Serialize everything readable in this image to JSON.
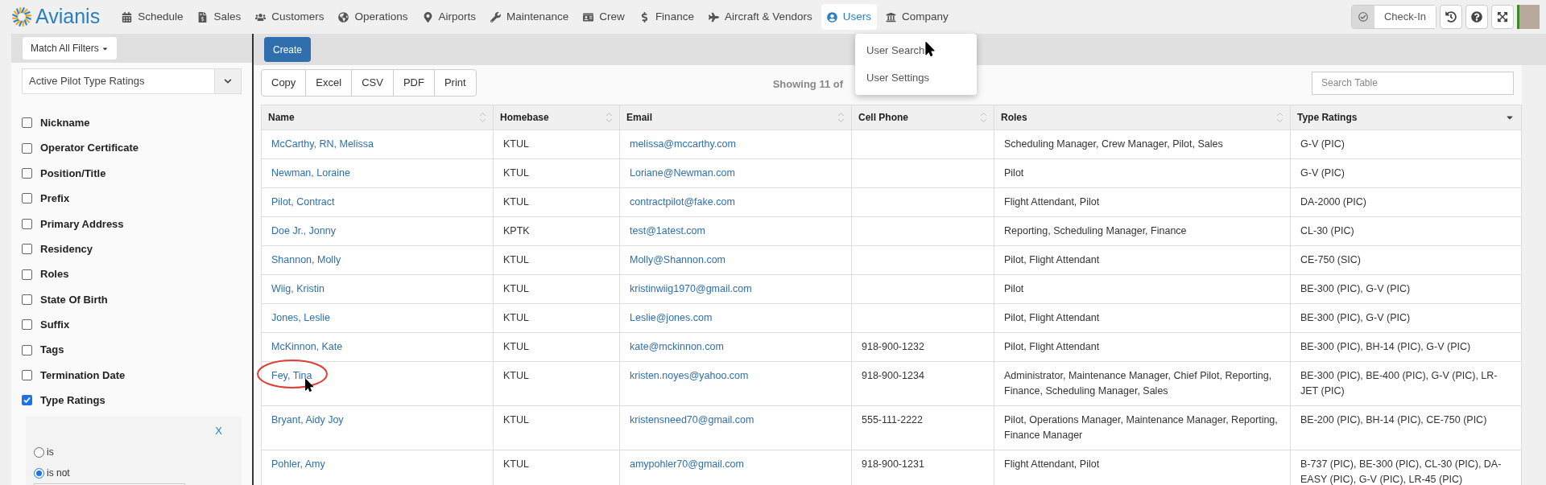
{
  "brand": "Avianis",
  "nav": [
    {
      "label": "Schedule",
      "selected": false
    },
    {
      "label": "Sales",
      "selected": false
    },
    {
      "label": "Customers",
      "selected": false
    },
    {
      "label": "Operations",
      "selected": false
    },
    {
      "label": "Airports",
      "selected": false
    },
    {
      "label": "Maintenance",
      "selected": false
    },
    {
      "label": "Crew",
      "selected": false
    },
    {
      "label": "Finance",
      "selected": false
    },
    {
      "label": "Aircraft & Vendors",
      "selected": false
    },
    {
      "label": "Users",
      "selected": true
    },
    {
      "label": "Company",
      "selected": false
    }
  ],
  "checkin": "Check-In",
  "user_menu": [
    "User Search",
    "User Settings"
  ],
  "sidebar": {
    "match_button": "Match All Filters",
    "select_value": "Active Pilot Type Ratings",
    "filters": [
      {
        "label": "Nickname",
        "checked": false
      },
      {
        "label": "Operator Certificate",
        "checked": false
      },
      {
        "label": "Position/Title",
        "checked": false
      },
      {
        "label": "Prefix",
        "checked": false
      },
      {
        "label": "Primary Address",
        "checked": false
      },
      {
        "label": "Residency",
        "checked": false
      },
      {
        "label": "Roles",
        "checked": false
      },
      {
        "label": "State Of Birth",
        "checked": false
      },
      {
        "label": "Suffix",
        "checked": false
      },
      {
        "label": "Tags",
        "checked": false
      },
      {
        "label": "Termination Date",
        "checked": false
      },
      {
        "label": "Type Ratings",
        "checked": true
      }
    ],
    "panel": {
      "close": "X",
      "options": [
        {
          "label": "is",
          "selected": false
        },
        {
          "label": "is not",
          "selected": true
        }
      ]
    }
  },
  "create_button": "Create",
  "export_buttons": [
    "Copy",
    "Excel",
    "CSV",
    "PDF",
    "Print"
  ],
  "showing": "Showing 11 of",
  "search": {
    "placeholder": "Search Table"
  },
  "table": {
    "columns": [
      {
        "label": "Name",
        "sorted": false
      },
      {
        "label": "Homebase",
        "sorted": false
      },
      {
        "label": "Email",
        "sorted": false
      },
      {
        "label": "Cell Phone",
        "sorted": false
      },
      {
        "label": "Roles",
        "sorted": false
      },
      {
        "label": "Type Ratings",
        "sorted": true
      }
    ],
    "rows": [
      [
        "McCarthy, RN, Melissa",
        "KTUL",
        "melissa@mccarthy.com",
        "",
        "Scheduling Manager, Crew Manager, Pilot, Sales",
        "G-V (PIC)"
      ],
      [
        "Newman, Loraine",
        "KTUL",
        "Loriane@Newman.com",
        "",
        "Pilot",
        "G-V (PIC)"
      ],
      [
        "Pilot, Contract",
        "KTUL",
        "contractpilot@fake.com",
        "",
        "Flight Attendant, Pilot",
        "DA-2000 (PIC)"
      ],
      [
        "Doe Jr., Jonny",
        "KPTK",
        "test@1atest.com",
        "",
        "Reporting, Scheduling Manager, Finance",
        "CL-30 (PIC)"
      ],
      [
        "Shannon, Molly",
        "KTUL",
        "Molly@Shannon.com",
        "",
        "Pilot, Flight Attendant",
        "CE-750 (SIC)"
      ],
      [
        "Wiig, Kristin",
        "KTUL",
        "kristinwiig1970@gmail.com",
        "",
        "Pilot",
        "BE-300 (PIC), G-V (PIC)"
      ],
      [
        "Jones, Leslie",
        "KTUL",
        "Leslie@jones.com",
        "",
        "Pilot, Flight Attendant",
        "BE-300 (PIC), G-V (PIC)"
      ],
      [
        "McKinnon, Kate",
        "KTUL",
        "kate@mckinnon.com",
        "918-900-1232",
        "Pilot, Flight Attendant",
        "BE-300 (PIC), BH-14 (PIC), G-V (PIC)"
      ],
      [
        "Fey, Tina",
        "KTUL",
        "kristen.noyes@yahoo.com",
        "918-900-1234",
        "Administrator, Maintenance Manager, Chief Pilot, Reporting, Finance, Scheduling Manager, Sales",
        "BE-300 (PIC), BE-400 (PIC), G-V (PIC), LR-JET (PIC)"
      ],
      [
        "Bryant, Aidy Joy",
        "KTUL",
        "kristensneed70@gmail.com",
        "555-111-2222",
        "Pilot, Operations Manager, Maintenance Manager, Reporting, Finance Manager",
        "BE-200 (PIC), BH-14 (PIC), CE-750 (PIC)"
      ],
      [
        "Pohler, Amy",
        "KTUL",
        "amypohler70@gmail.com",
        "918-900-1231",
        "Flight Attendant, Pilot",
        "B-737 (PIC), BE-300 (PIC), CL-30 (PIC), DA-EASY (PIC), G-V (PIC), LR-45 (PIC)"
      ]
    ]
  }
}
